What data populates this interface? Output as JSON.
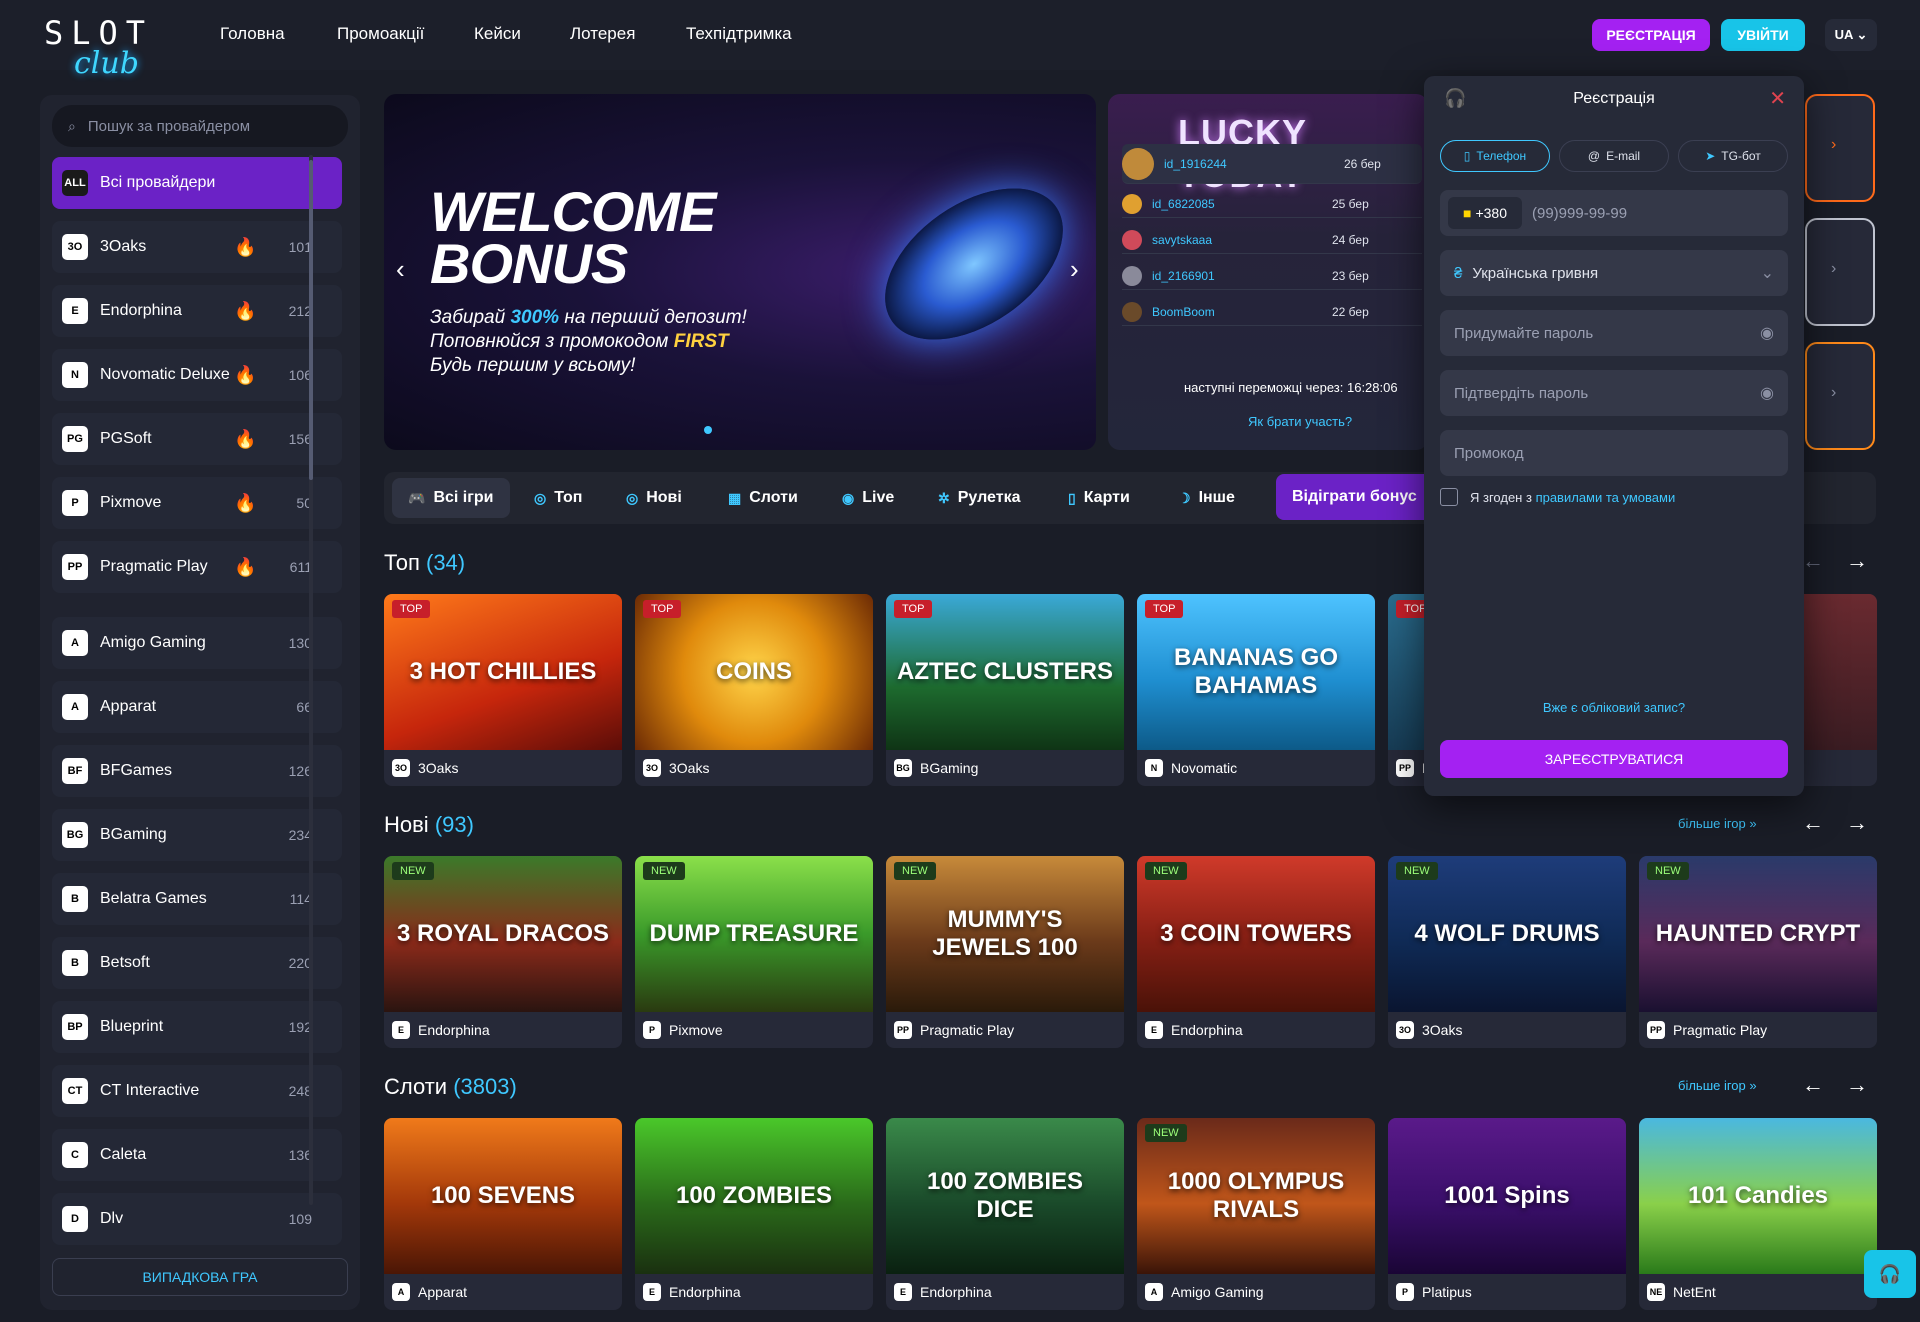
{
  "header": {
    "logo": {
      "top": "SLOT",
      "bottom": "club"
    },
    "nav": [
      "Головна",
      "Промоакції",
      "Кейси",
      "Лотерея",
      "Техпідтримка"
    ],
    "register_label": "РЕЄСТРАЦІЯ",
    "login_label": "УВІЙТИ",
    "lang_label": "UA ⌄"
  },
  "sidebar": {
    "search_placeholder": "Пошук за провайдером",
    "random_label": "ВИПАДКОВА ГРА",
    "providers": [
      {
        "name": "Всі провайдери",
        "icon": "ALL",
        "count": ""
      },
      {
        "name": "3Oaks",
        "icon": "3O",
        "count": "101",
        "hot": true
      },
      {
        "name": "Endorphina",
        "icon": "E",
        "count": "212",
        "hot": true
      },
      {
        "name": "Novomatic Deluxe",
        "icon": "N",
        "count": "106",
        "hot": true
      },
      {
        "name": "PGSoft",
        "icon": "PG",
        "count": "156",
        "hot": true
      },
      {
        "name": "Pixmove",
        "icon": "P",
        "count": "50",
        "hot": true
      },
      {
        "name": "Pragmatic Play",
        "icon": "PP",
        "count": "611",
        "hot": true
      },
      {
        "name": "Amigo Gaming",
        "icon": "A",
        "count": "130"
      },
      {
        "name": "Apparat",
        "icon": "A",
        "count": "66"
      },
      {
        "name": "BFGames",
        "icon": "BF",
        "count": "126"
      },
      {
        "name": "BGaming",
        "icon": "BG",
        "count": "234"
      },
      {
        "name": "Belatra Games",
        "icon": "B",
        "count": "114"
      },
      {
        "name": "Betsoft",
        "icon": "B",
        "count": "220"
      },
      {
        "name": "Blueprint",
        "icon": "BP",
        "count": "192"
      },
      {
        "name": "CT Interactive",
        "icon": "CT",
        "count": "248"
      },
      {
        "name": "Caleta",
        "icon": "C",
        "count": "136"
      },
      {
        "name": "Dlv",
        "icon": "D",
        "count": "109"
      }
    ]
  },
  "banner": {
    "title_line1": "WELCOME",
    "title_line2": "BONUS",
    "sub1_pre": "Забирай ",
    "sub1_hl": "300%",
    "sub1_post": " на перший депозит!",
    "sub2_pre": "Поповнюйся з промокодом ",
    "sub2_hl": "FIRST",
    "sub3": "Будь першим у всьому!"
  },
  "lucky": {
    "title": "LUCKY TODAY",
    "rows": [
      {
        "id": "id_1916244",
        "date": "26 бер"
      },
      {
        "id": "id_6822085",
        "date": "25 бер"
      },
      {
        "id": "savytskaaa",
        "date": "24 бер"
      },
      {
        "id": "id_2166901",
        "date": "23 бер"
      },
      {
        "id": "BoomBoom",
        "date": "22 бер"
      }
    ],
    "next_label": "наступні переможці через: 16:28:06",
    "how_label": "Як брати участь?"
  },
  "categories": [
    "Всі ігри",
    "Топ",
    "Нові",
    "Слоти",
    "Live",
    "Рулетка",
    "Карти",
    "Інше"
  ],
  "bonus_label": "Відіграти бонус",
  "sections": {
    "top": {
      "title": "Топ",
      "count": "(34)",
      "games": [
        {
          "title": "3 HOT CHILLIES",
          "provider": "3Oaks",
          "icon": "3O",
          "tag": "TOP",
          "bg": "linear-gradient(160deg,#ff7a1a,#c6260c 60%,#5b0d08)"
        },
        {
          "title": "COINS",
          "provider": "3Oaks",
          "icon": "3O",
          "tag": "TOP",
          "bg": "radial-gradient(circle,#ffd54a,#e08a0c 50%,#6b2a05)"
        },
        {
          "title": "AZTEC CLUSTERS",
          "provider": "BGaming",
          "icon": "BG",
          "tag": "TOP",
          "bg": "linear-gradient(180deg,#3aa9d8,#1d6a2e 60%,#0f3415)"
        },
        {
          "title": "BANANAS GO BAHAMAS",
          "provider": "Novomatic",
          "icon": "N",
          "tag": "TOP",
          "bg": "linear-gradient(180deg,#4ec3ff,#1f8fd1 55%,#0d5a88)"
        },
        {
          "title": "",
          "provider": "P",
          "icon": "PP",
          "tag": "TOP",
          "bg": "linear-gradient(180deg,#2a6d8f,#173c55)"
        },
        {
          "title": "",
          "provider": "",
          "icon": "",
          "tag": "",
          "bg": "linear-gradient(180deg,#6a2a30,#3a1c22)"
        }
      ]
    },
    "new": {
      "title": "Нові",
      "count": "(93)",
      "more": "більше ігор »",
      "games": [
        {
          "title": "3 ROYAL DRACOS",
          "provider": "Endorphina",
          "icon": "E",
          "tag": "NEW",
          "bg": "linear-gradient(180deg,#3b7a2a,#8b2a1a 55%,#2a1410)"
        },
        {
          "title": "DUMP TREASURE",
          "provider": "Pixmove",
          "icon": "P",
          "tag": "NEW",
          "bg": "linear-gradient(180deg,#8be04a,#3a9a2a 50%,#2a3a10)"
        },
        {
          "title": "MUMMY'S JEWELS 100",
          "provider": "Pragmatic Play",
          "icon": "PP",
          "tag": "NEW",
          "bg": "linear-gradient(180deg,#c78a3a,#6b3a1a 55%,#2a1a0a)"
        },
        {
          "title": "3 COIN TOWERS",
          "provider": "Endorphina",
          "icon": "E",
          "tag": "NEW",
          "bg": "linear-gradient(180deg,#d03a2a,#8a2015 50%,#4a1208)"
        },
        {
          "title": "4 WOLF DRUMS",
          "provider": "3Oaks",
          "icon": "3O",
          "tag": "NEW",
          "bg": "linear-gradient(180deg,#1e3c7a,#0f2a55 55%,#0a1530)"
        },
        {
          "title": "HAUNTED CRYPT",
          "provider": "Pragmatic Play",
          "icon": "PP",
          "tag": "NEW",
          "bg": "linear-gradient(180deg,#2a3a6a,#5a2a5a 55%,#1a1030)"
        }
      ]
    },
    "slots": {
      "title": "Слоти",
      "count": "(3803)",
      "more": "більше ігор »",
      "games": [
        {
          "title": "100 SEVENS",
          "provider": "Apparat",
          "icon": "A",
          "tag": "",
          "bg": "linear-gradient(180deg,#f07a1a,#a3380a 55%,#4a1605)"
        },
        {
          "title": "100 ZOMBIES",
          "provider": "Endorphina",
          "icon": "E",
          "tag": "",
          "bg": "linear-gradient(180deg,#4ac82a,#2a6a1a 55%,#1a3010)"
        },
        {
          "title": "100 ZOMBIES DICE",
          "provider": "Endorphina",
          "icon": "E",
          "tag": "",
          "bg": "linear-gradient(180deg,#3a8a4a,#1a4a2a 55%,#0a2010)"
        },
        {
          "title": "1000 OLYMPUS RIVALS",
          "provider": "Amigo Gaming",
          "icon": "A",
          "tag": "NEW",
          "bg": "linear-gradient(180deg,#6a2a1a,#c0561a 55%,#3a1408)"
        },
        {
          "title": "1001 Spins",
          "provider": "Platipus",
          "icon": "P",
          "tag": "",
          "bg": "linear-gradient(180deg,#5a1a8a,#3a0f6a 55%,#1a0535)"
        },
        {
          "title": "101 Candies",
          "provider": "NetEnt",
          "icon": "NE",
          "tag": "",
          "bg": "linear-gradient(180deg,#4ab8e0,#8ad04a 55%,#2a7a1a)"
        }
      ]
    }
  },
  "modal": {
    "title": "Реєстрація",
    "tabs": [
      "Телефон",
      "E-mail",
      "TG-бот"
    ],
    "phone_code": "+380",
    "phone_placeholder": "(99)999-99-99",
    "currency": "Українська гривня",
    "password_placeholder": "Придумайте пароль",
    "confirm_placeholder": "Підтвердіть пароль",
    "promo_placeholder": "Промокод",
    "agree_text": "Я згоден з ",
    "agree_link": "правилами та умовами",
    "have_account": "Вже є обліковий запис?",
    "submit": "ЗАРЕЄСТРУВАТИСЯ"
  },
  "colors": {
    "accent": "#3fc8ff",
    "purple": "#6b22c6",
    "register": "#a421f2",
    "login": "#18c4e8"
  }
}
